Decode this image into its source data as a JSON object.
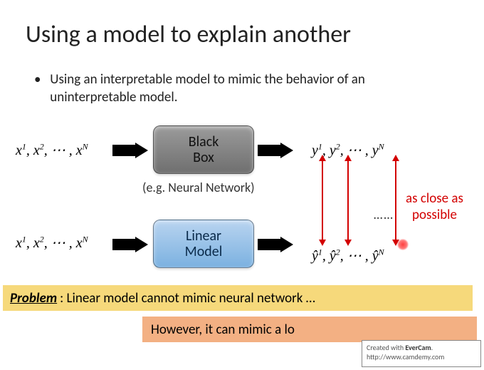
{
  "title": "Using a model to explain another",
  "bullet": "Using an interpretable model to mimic the behavior of an uninterpretable model.",
  "boxes": {
    "black": "Black\nBox",
    "linear": "Linear\nModel"
  },
  "caption_nn": "(e.g. Neural Network)",
  "math": {
    "inputs_html": "x<sup>1</sup>, x<sup>2</sup>, ⋯ , x<sup>N</sup>",
    "outputs_y_html": "y<sup>1</sup>, y<sup>2</sup>, ⋯ , y<sup>N</sup>",
    "outputs_yt_html": "ŷ<sup>1</sup>, ŷ<sup>2</sup>, ⋯ , ŷ<sup>N</sup>"
  },
  "red_label": "as close as\npossible",
  "dots": "……",
  "problem": {
    "label": "Problem",
    "text": ": Linear model cannot mimic neural network …"
  },
  "however": "However, it can mimic a lo",
  "watermark": {
    "line1": "Created with EverCam.",
    "line2": "http://www.camdemy.com"
  }
}
